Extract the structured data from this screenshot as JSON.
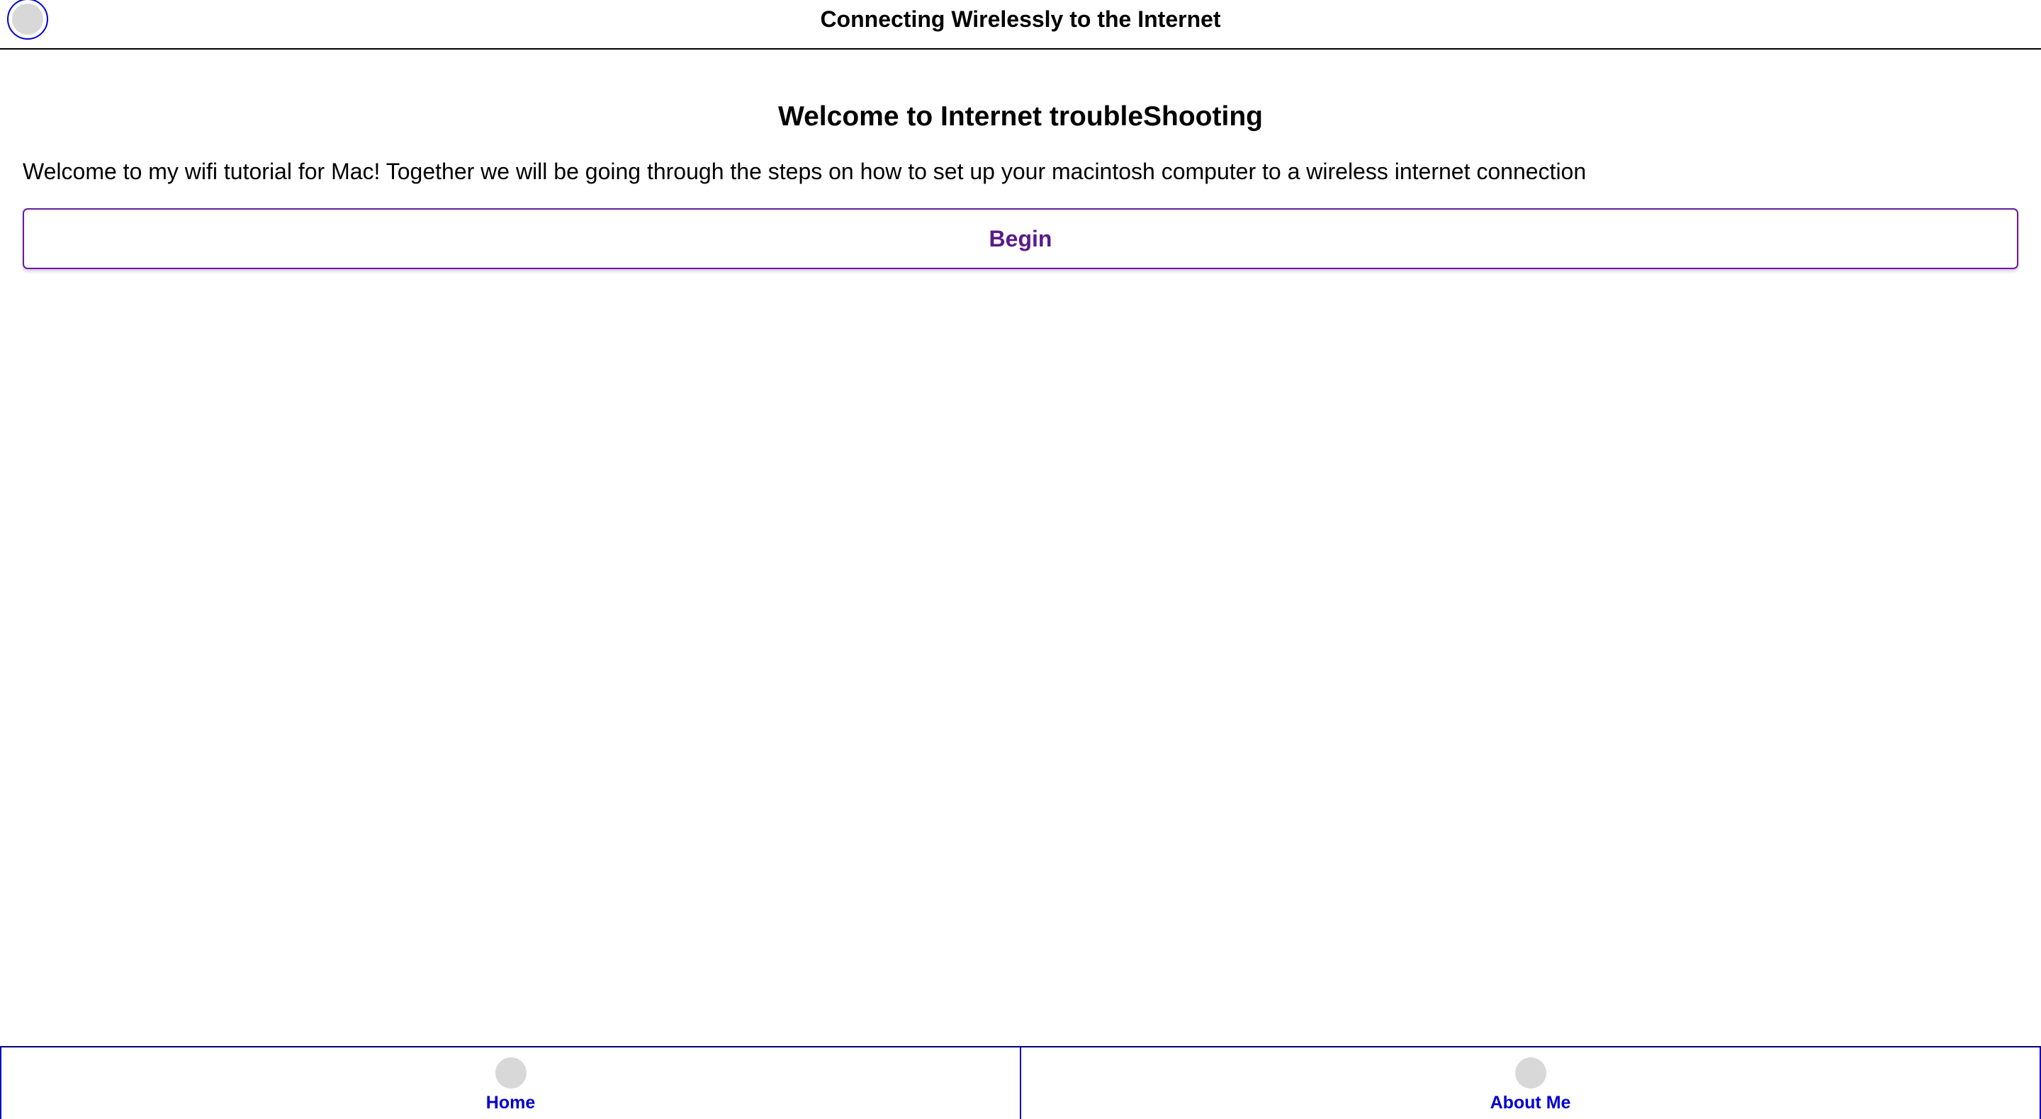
{
  "header": {
    "title": "Connecting Wirelessly to the Internet",
    "left_button_icon": "circle-icon"
  },
  "main": {
    "heading": "Welcome to Internet troubleShooting",
    "intro": "Welcome to my wifi tutorial for Mac! Together we will be going through the steps on how to set up your macintosh computer to a wireless internet connection",
    "begin_label": "Begin"
  },
  "footer": {
    "tabs": [
      {
        "label": "Home",
        "icon": "home-icon"
      },
      {
        "label": "About Me",
        "icon": "about-icon"
      }
    ]
  },
  "colors": {
    "link": "#0000cc",
    "accent": "#5a1a8a",
    "icon_placeholder": "#d8d8d8"
  }
}
